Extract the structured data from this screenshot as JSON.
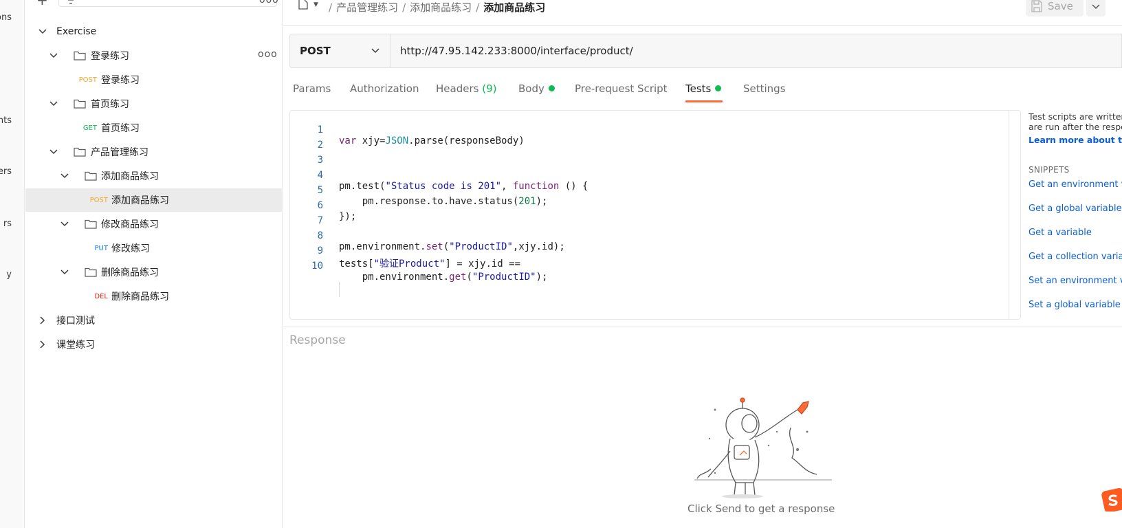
{
  "rail": {
    "items": [
      "ons",
      "ents",
      "rvers",
      "rs",
      "y"
    ]
  },
  "sidebar": {
    "more_label": "ooo",
    "tree": [
      {
        "type": "collection",
        "label": "Exercise",
        "expanded": true
      },
      {
        "type": "folder",
        "label": "登录练习",
        "expanded": true
      },
      {
        "type": "request",
        "method": "POST",
        "label": "登录练习"
      },
      {
        "type": "folder",
        "label": "首页练习",
        "expanded": true
      },
      {
        "type": "request",
        "method": "GET",
        "label": "首页练习"
      },
      {
        "type": "folder",
        "label": "产品管理练习",
        "expanded": true
      },
      {
        "type": "folder",
        "label": "添加商品练习",
        "expanded": true
      },
      {
        "type": "request",
        "method": "POST",
        "label": "添加商品练习",
        "selected": true
      },
      {
        "type": "folder",
        "label": "修改商品练习",
        "expanded": true
      },
      {
        "type": "request",
        "method": "PUT",
        "label": "修改练习"
      },
      {
        "type": "folder",
        "label": "删除商品练习",
        "expanded": true
      },
      {
        "type": "request",
        "method": "DEL",
        "label": "删除商品练习"
      },
      {
        "type": "collection",
        "label": "接口测试",
        "expanded": false
      },
      {
        "type": "collection",
        "label": "课堂练习",
        "expanded": false
      }
    ]
  },
  "header": {
    "breadcrumb": [
      "产品管理练习",
      "添加商品练习",
      "添加商品练习"
    ],
    "save_label": "Save"
  },
  "request": {
    "method": "POST",
    "url": "http://47.95.142.233:8000/interface/product/"
  },
  "tabs": [
    {
      "label": "Params"
    },
    {
      "label": "Authorization"
    },
    {
      "label": "Headers",
      "count": "(9)"
    },
    {
      "label": "Body",
      "dot": true
    },
    {
      "label": "Pre-request Script"
    },
    {
      "label": "Tests",
      "dot": true,
      "active": true
    },
    {
      "label": "Settings"
    }
  ],
  "editor": {
    "line_numbers": [
      "1",
      "2",
      "3",
      "4",
      "5",
      "6",
      "7",
      "8",
      "9",
      "10"
    ],
    "lines": [
      "var xjy=JSON.parse(responseBody)",
      "",
      "",
      "pm.test(\"Status code is 201\", function () {",
      "    pm.response.to.have.status(201);",
      "});",
      "",
      "pm.environment.set(\"ProductID\",xjy.id);",
      "tests[\"验证Product\"] = xjy.id ==",
      "    pm.environment.get(\"ProductID\");"
    ]
  },
  "side_panel": {
    "desc_1": "Test scripts are written",
    "desc_2": "are run after the respon",
    "learn": "Learn more about tests",
    "snippets_title": "SNIPPETS",
    "snippets": [
      "Get an environment var",
      "Get a global variable",
      "Get a variable",
      "Get a collection variabl",
      "Set an environment var",
      "Set a global variable"
    ]
  },
  "response": {
    "title": "Response",
    "empty_message": "Click Send to get a response"
  },
  "colors": {
    "accent": "#ff6c37",
    "post": "#f5a623",
    "get": "#0cbb52",
    "put": "#097bed",
    "del": "#eb2013",
    "dot": "#0cbb52",
    "link": "#0a5fd8"
  }
}
